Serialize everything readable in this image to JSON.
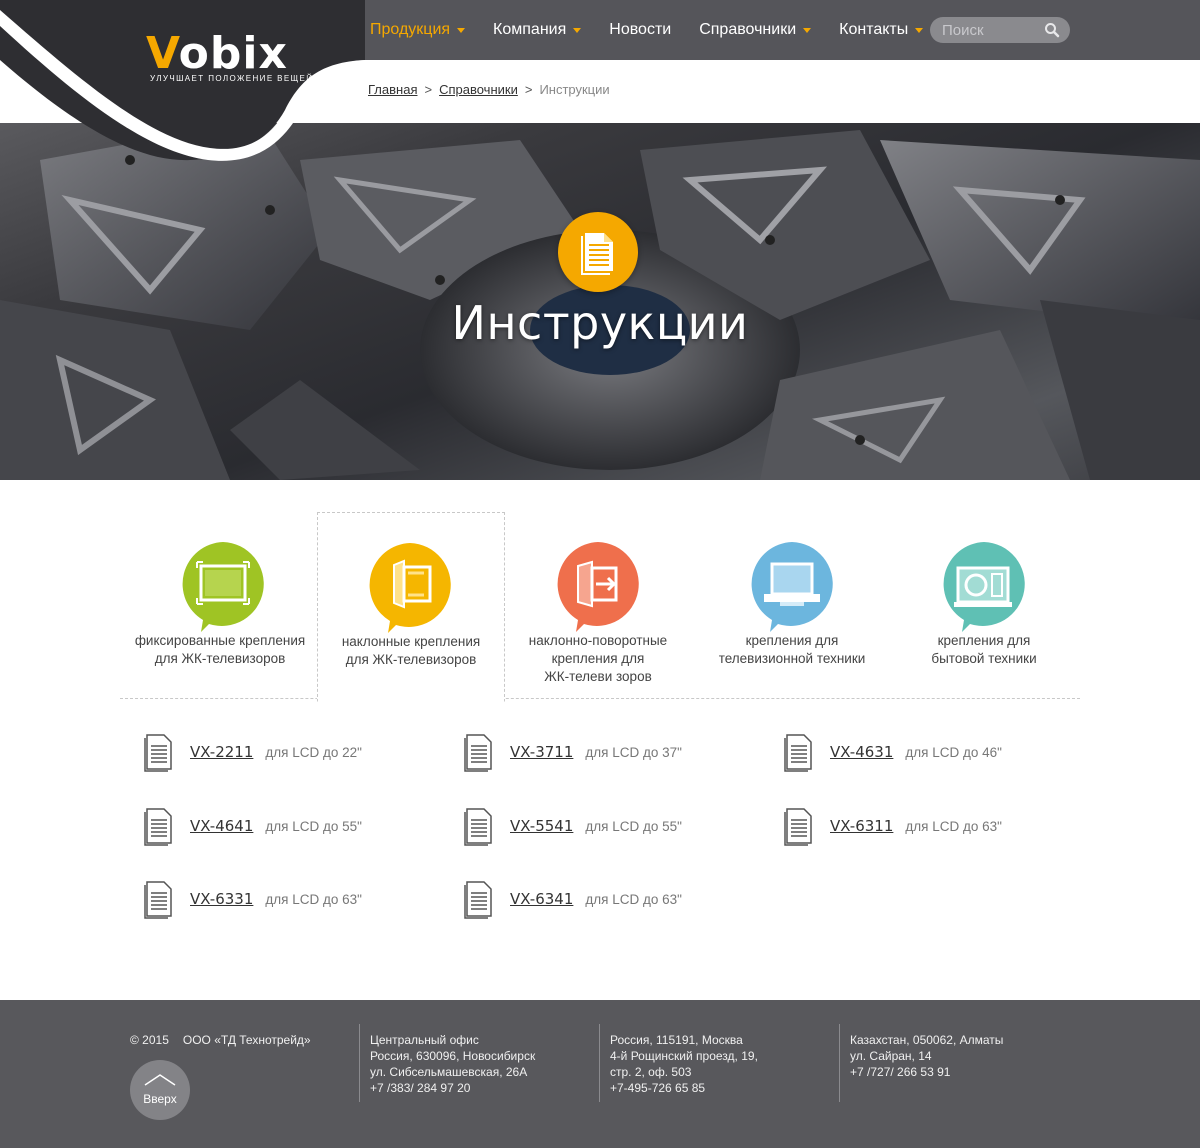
{
  "brand": {
    "name_v": "V",
    "name_rest": "obix",
    "tagline": "улучшает положение вещей",
    "accent": "#f5a800"
  },
  "nav": {
    "items": [
      {
        "label": "Продукция",
        "active": true,
        "has_dropdown": true
      },
      {
        "label": "Компания",
        "active": false,
        "has_dropdown": true
      },
      {
        "label": "Новости",
        "active": false,
        "has_dropdown": false
      },
      {
        "label": "Справочники",
        "active": false,
        "has_dropdown": true
      },
      {
        "label": "Контакты",
        "active": false,
        "has_dropdown": true
      }
    ],
    "search_placeholder": "Поиск",
    "search_icon": "magnifier-icon"
  },
  "breadcrumb": {
    "home": "Главная",
    "section": "Справочники",
    "separator": ">",
    "current": "Инструкции"
  },
  "hero": {
    "title": "Инструкции",
    "icon": "document-icon"
  },
  "categories": [
    {
      "label_lines": [
        "фиксированные крепления",
        "для ЖК-телевизоров"
      ],
      "color": "#9fc424",
      "icon": "fixed-mount-icon",
      "selected": false
    },
    {
      "label_lines": [
        "наклонные крепления",
        "для ЖК-телевизоров"
      ],
      "color": "#f5b600",
      "icon": "tilt-mount-icon",
      "selected": true
    },
    {
      "label_lines": [
        "наклонно-поворотные",
        "крепления для",
        "ЖК-телеви зоров"
      ],
      "color": "#ef6f4c",
      "icon": "swivel-mount-icon",
      "selected": false
    },
    {
      "label_lines": [
        "крепления для",
        "телевизионной техники"
      ],
      "color": "#6cb6de",
      "icon": "tv-mount-icon",
      "selected": false
    },
    {
      "label_lines": [
        "крепления для",
        "бытовой техники"
      ],
      "color": "#5fc0b4",
      "icon": "appliance-mount-icon",
      "selected": false
    }
  ],
  "documents": [
    {
      "code": "VX-2211",
      "desc": "для LCD до 22\""
    },
    {
      "code": "VX-3711",
      "desc": "для LCD до 37\""
    },
    {
      "code": "VX-4631",
      "desc": "для LCD до 46\""
    },
    {
      "code": "VX-4641",
      "desc": "для LCD до 55\""
    },
    {
      "code": "VX-5541",
      "desc": "для LCD до 55\""
    },
    {
      "code": "VX-6311",
      "desc": "для LCD до 63\""
    },
    {
      "code": "VX-6331",
      "desc": "для LCD до 63\""
    },
    {
      "code": "VX-6341",
      "desc": "для LCD до 63\""
    }
  ],
  "footer": {
    "year": "© 2015",
    "company": "ООО «ТД Технотрейд»",
    "to_top": "Вверх",
    "offices": [
      [
        "Центральный офис",
        "Россия, 630096, Новосибирск",
        "ул. Сибсельмашевская, 26А",
        "+7 /383/ 284 97 20"
      ],
      [
        "Россия, 115191, Москва",
        "4-й Рощинский проезд, 19,",
        "стр. 2, оф. 503",
        "+7-495-726 65 85"
      ],
      [
        "Казахстан, 050062, Алматы",
        "ул. Сайран, 14",
        "+7 /727/ 266 53 91"
      ]
    ]
  }
}
